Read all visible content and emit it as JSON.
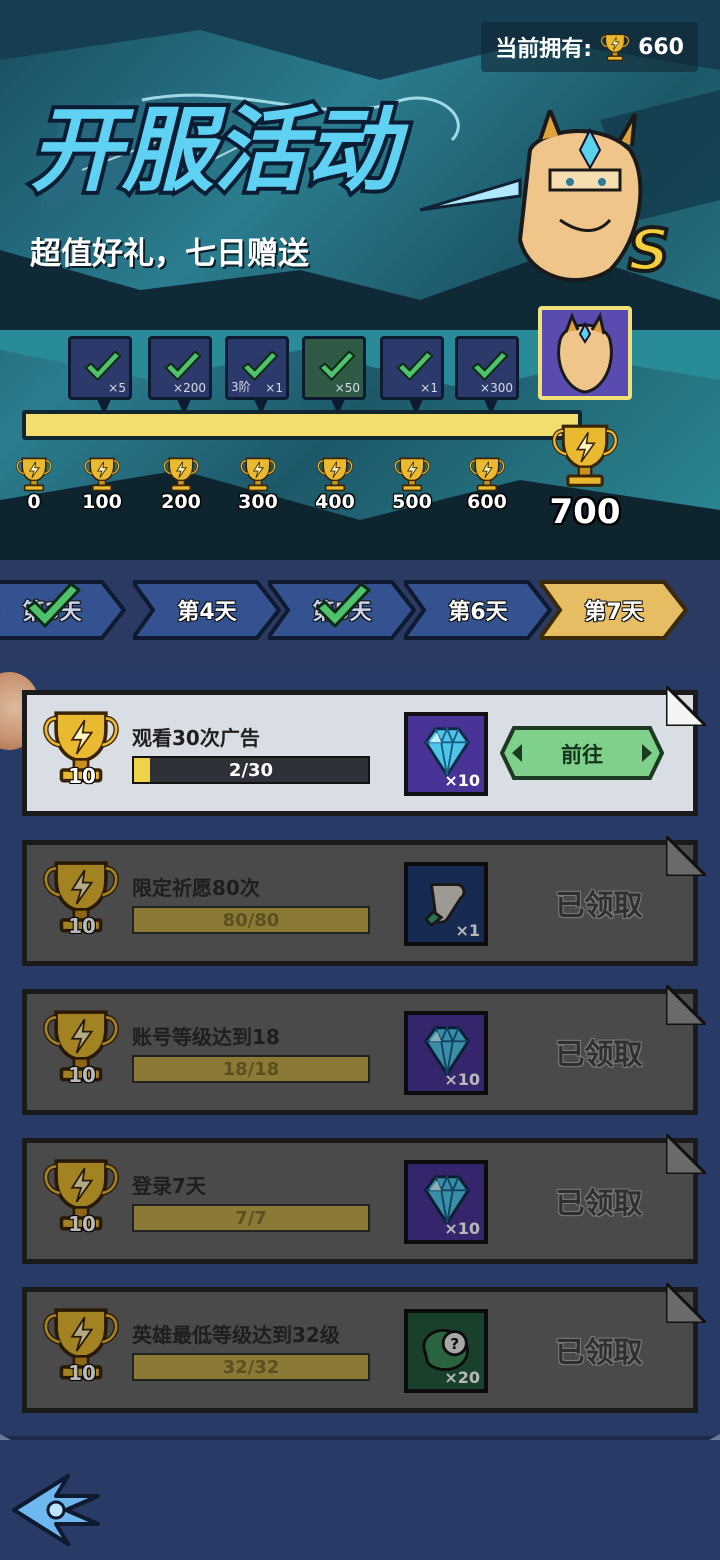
{
  "header": {
    "owned_label": "当前拥有:",
    "owned_value": "660",
    "event_title": "开服活动",
    "subtitle": "超值好礼，七日赠送",
    "hero_rank": "S"
  },
  "milestones": [
    {
      "points": "0",
      "qty": "×5",
      "icon": "bracer-icon"
    },
    {
      "points": "100",
      "qty": "×200",
      "icon": "diamond-icon"
    },
    {
      "points": "200",
      "qty": "×1",
      "tier": "3阶",
      "icon": "gear-icon"
    },
    {
      "points": "300",
      "qty": "×50",
      "icon": "scroll-icon"
    },
    {
      "points": "400",
      "qty": "×1",
      "icon": "bracer-icon"
    },
    {
      "points": "500",
      "qty": "×300",
      "icon": "diamond-icon"
    },
    {
      "points": "600",
      "icon": "trophy-icon"
    },
    {
      "points": "700",
      "icon": "hero-portrait-icon"
    }
  ],
  "tabs": [
    {
      "label": "第3天",
      "done": true
    },
    {
      "label": "第4天",
      "done": false
    },
    {
      "label": "第5天",
      "done": true
    },
    {
      "label": "第6天",
      "done": false
    },
    {
      "label": "第7天",
      "done": false,
      "selected": true
    }
  ],
  "tasks": [
    {
      "points": "10",
      "name": "观看30次广告",
      "progress": "2/30",
      "progress_fraction": 0.067,
      "reward_qty": "×10",
      "reward_icon": "diamond-icon",
      "action": "前往",
      "state": "active"
    },
    {
      "points": "10",
      "name": "限定祈愿80次",
      "progress": "80/80",
      "progress_fraction": 1,
      "reward_qty": "×1",
      "reward_icon": "scroll-icon",
      "action": "已领取",
      "state": "claimed"
    },
    {
      "points": "10",
      "name": "账号等级达到18",
      "progress": "18/18",
      "progress_fraction": 1,
      "reward_qty": "×10",
      "reward_icon": "diamond-icon",
      "action": "已领取",
      "state": "claimed"
    },
    {
      "points": "10",
      "name": "登录7天",
      "progress": "7/7",
      "progress_fraction": 1,
      "reward_qty": "×10",
      "reward_icon": "diamond-icon",
      "action": "已领取",
      "state": "claimed"
    },
    {
      "points": "10",
      "name": "英雄最低等级达到32级",
      "progress": "32/32",
      "progress_fraction": 1,
      "reward_qty": "×20",
      "reward_icon": "mystery-box-icon",
      "action": "已领取",
      "state": "claimed"
    }
  ],
  "colors": {
    "accent_gold": "#f2d44c",
    "selected_tab": "#e6bd62",
    "tab_blue": "#33528f",
    "go_button": "#7fd08a",
    "check_green": "#4ec26d"
  }
}
